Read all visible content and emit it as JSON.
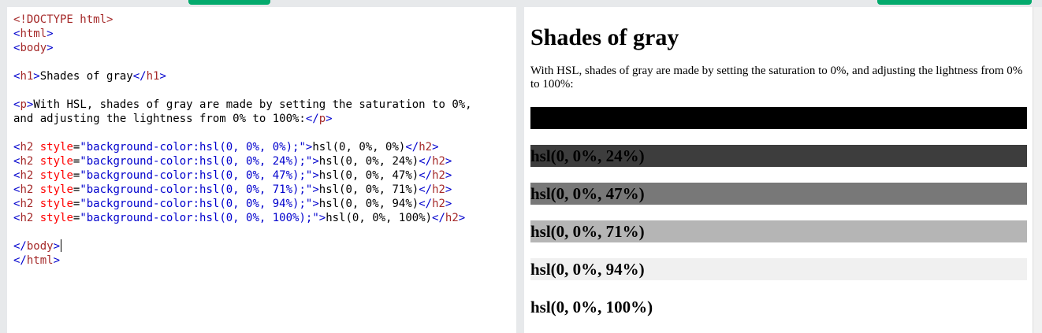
{
  "editor": {
    "lines": [
      [
        {
          "c": "tg",
          "t": "<!DOCTYPE html>"
        }
      ],
      [
        {
          "c": "br",
          "t": "<"
        },
        {
          "c": "tg",
          "t": "html"
        },
        {
          "c": "br",
          "t": ">"
        }
      ],
      [
        {
          "c": "br",
          "t": "<"
        },
        {
          "c": "tg",
          "t": "body"
        },
        {
          "c": "br",
          "t": ">"
        }
      ],
      [],
      [
        {
          "c": "br",
          "t": "<"
        },
        {
          "c": "tg",
          "t": "h1"
        },
        {
          "c": "br",
          "t": ">"
        },
        {
          "c": "tx",
          "t": "Shades of gray"
        },
        {
          "c": "br",
          "t": "</"
        },
        {
          "c": "tg",
          "t": "h1"
        },
        {
          "c": "br",
          "t": ">"
        }
      ],
      [],
      [
        {
          "c": "br",
          "t": "<"
        },
        {
          "c": "tg",
          "t": "p"
        },
        {
          "c": "br",
          "t": ">"
        },
        {
          "c": "tx",
          "t": "With HSL, shades of gray are made by setting the saturation to 0%,"
        }
      ],
      [
        {
          "c": "tx",
          "t": "and adjusting the lightness from 0% to 100%:"
        },
        {
          "c": "br",
          "t": "</"
        },
        {
          "c": "tg",
          "t": "p"
        },
        {
          "c": "br",
          "t": ">"
        }
      ],
      [],
      [
        {
          "c": "br",
          "t": "<"
        },
        {
          "c": "tg",
          "t": "h2"
        },
        {
          "c": "at",
          "t": " style"
        },
        {
          "c": "tx",
          "t": "="
        },
        {
          "c": "av",
          "t": "\"background-color:hsl(0, 0%, 0%);\""
        },
        {
          "c": "br",
          "t": ">"
        },
        {
          "c": "tx",
          "t": "hsl(0, 0%, 0%)"
        },
        {
          "c": "br",
          "t": "</"
        },
        {
          "c": "tg",
          "t": "h2"
        },
        {
          "c": "br",
          "t": ">"
        }
      ],
      [
        {
          "c": "br",
          "t": "<"
        },
        {
          "c": "tg",
          "t": "h2"
        },
        {
          "c": "at",
          "t": " style"
        },
        {
          "c": "tx",
          "t": "="
        },
        {
          "c": "av",
          "t": "\"background-color:hsl(0, 0%, 24%);\""
        },
        {
          "c": "br",
          "t": ">"
        },
        {
          "c": "tx",
          "t": "hsl(0, 0%, 24%)"
        },
        {
          "c": "br",
          "t": "</"
        },
        {
          "c": "tg",
          "t": "h2"
        },
        {
          "c": "br",
          "t": ">"
        }
      ],
      [
        {
          "c": "br",
          "t": "<"
        },
        {
          "c": "tg",
          "t": "h2"
        },
        {
          "c": "at",
          "t": " style"
        },
        {
          "c": "tx",
          "t": "="
        },
        {
          "c": "av",
          "t": "\"background-color:hsl(0, 0%, 47%);\""
        },
        {
          "c": "br",
          "t": ">"
        },
        {
          "c": "tx",
          "t": "hsl(0, 0%, 47%)"
        },
        {
          "c": "br",
          "t": "</"
        },
        {
          "c": "tg",
          "t": "h2"
        },
        {
          "c": "br",
          "t": ">"
        }
      ],
      [
        {
          "c": "br",
          "t": "<"
        },
        {
          "c": "tg",
          "t": "h2"
        },
        {
          "c": "at",
          "t": " style"
        },
        {
          "c": "tx",
          "t": "="
        },
        {
          "c": "av",
          "t": "\"background-color:hsl(0, 0%, 71%);\""
        },
        {
          "c": "br",
          "t": ">"
        },
        {
          "c": "tx",
          "t": "hsl(0, 0%, 71%)"
        },
        {
          "c": "br",
          "t": "</"
        },
        {
          "c": "tg",
          "t": "h2"
        },
        {
          "c": "br",
          "t": ">"
        }
      ],
      [
        {
          "c": "br",
          "t": "<"
        },
        {
          "c": "tg",
          "t": "h2"
        },
        {
          "c": "at",
          "t": " style"
        },
        {
          "c": "tx",
          "t": "="
        },
        {
          "c": "av",
          "t": "\"background-color:hsl(0, 0%, 94%);\""
        },
        {
          "c": "br",
          "t": ">"
        },
        {
          "c": "tx",
          "t": "hsl(0, 0%, 94%)"
        },
        {
          "c": "br",
          "t": "</"
        },
        {
          "c": "tg",
          "t": "h2"
        },
        {
          "c": "br",
          "t": ">"
        }
      ],
      [
        {
          "c": "br",
          "t": "<"
        },
        {
          "c": "tg",
          "t": "h2"
        },
        {
          "c": "at",
          "t": " style"
        },
        {
          "c": "tx",
          "t": "="
        },
        {
          "c": "av",
          "t": "\"background-color:hsl(0, 0%, 100%);\""
        },
        {
          "c": "br",
          "t": ">"
        },
        {
          "c": "tx",
          "t": "hsl(0, 0%, 100%)"
        },
        {
          "c": "br",
          "t": "</"
        },
        {
          "c": "tg",
          "t": "h2"
        },
        {
          "c": "br",
          "t": ">"
        }
      ],
      [],
      [
        {
          "c": "br",
          "t": "</"
        },
        {
          "c": "tg",
          "t": "body"
        },
        {
          "c": "br",
          "t": ">"
        },
        {
          "c": "caret",
          "t": ""
        }
      ],
      [
        {
          "c": "br",
          "t": "</"
        },
        {
          "c": "tg",
          "t": "html"
        },
        {
          "c": "br",
          "t": ">"
        }
      ]
    ]
  },
  "result": {
    "heading": "Shades of gray",
    "paragraph": "With HSL, shades of gray are made by setting the saturation to 0%, and adjusting the lightness from 0% to 100%:",
    "shades": [
      {
        "label": "hsl(0, 0%, 0%)",
        "bg": "hsl(0, 0%, 0%)",
        "gap_before": 20
      },
      {
        "label": "hsl(0, 0%, 24%)",
        "bg": "hsl(0, 0%, 24%)",
        "gap_before": 20
      },
      {
        "label": "hsl(0, 0%, 47%)",
        "bg": "hsl(0, 0%, 47%)",
        "gap_before": 20
      },
      {
        "label": "hsl(0, 0%, 71%)",
        "bg": "hsl(0, 0%, 71%)",
        "gap_before": 20
      },
      {
        "label": "hsl(0, 0%, 94%)",
        "bg": "hsl(0, 0%, 94%)",
        "gap_before": 20
      },
      {
        "label": "hsl(0, 0%, 100%)",
        "bg": "hsl(0, 0%, 100%)",
        "gap_before": 20
      }
    ]
  },
  "colors": {
    "accent": "#04aa6d",
    "frame": "#e7e9eb"
  }
}
